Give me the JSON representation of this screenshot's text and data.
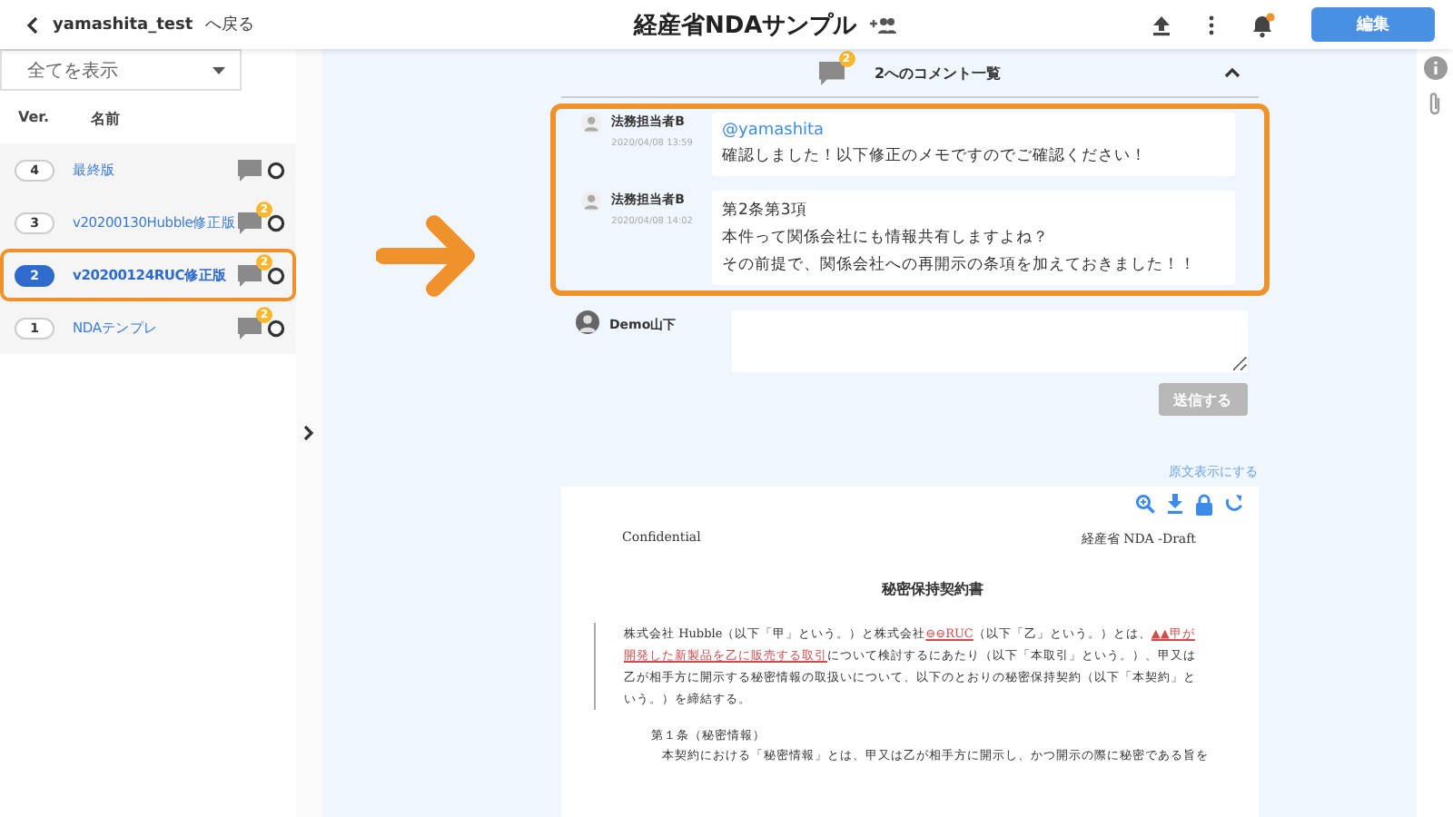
{
  "header": {
    "back_user": "yamashita_test",
    "back_label": "へ戻る",
    "title": "経産省NDAサンプル",
    "notification_dot": true,
    "edit_button": "編集"
  },
  "sidebar": {
    "filter": "全てを表示",
    "columns": [
      "Ver.",
      "名前"
    ],
    "versions": [
      {
        "ver": "4",
        "name": "最終版",
        "selected": false
      },
      {
        "ver": "3",
        "name": "v20200130Hubble修正版",
        "selected": false,
        "badge": "2"
      },
      {
        "ver": "2",
        "name": "v20200124RUC修正版",
        "selected": true,
        "badge": "2"
      },
      {
        "ver": "1",
        "name": "NDAテンプレ",
        "selected": false,
        "badge": "2"
      }
    ]
  },
  "comments": {
    "badge": "2",
    "title": "2へのコメント一覧",
    "expanded": true,
    "items": [
      {
        "author": "法務担当者B",
        "date": "2020/04/08 13:59",
        "mention": "@yamashita",
        "lines": [
          "確認しました！以下修正のメモですのでご確認ください！"
        ]
      },
      {
        "author": "法務担当者B",
        "date": "2020/04/08 14:02",
        "lines": [
          "第2条第3項",
          "本件って関係会社にも情報共有しますよね？",
          "その前提で、関係会社への再開示の条項を加えておきました！！"
        ]
      }
    ],
    "composer": {
      "user": "Demo山下",
      "send_button": "送信する",
      "send_disabled": true
    }
  },
  "document": {
    "toggle_link": "原文表示にする",
    "header_left": "Confidential",
    "header_right": "経産省 NDA -Draft",
    "title": "秘密保持契約書",
    "paragraph": [
      {
        "text": "株式会社 Hubble（以下「甲」という。）と株式会社",
        "changed": false
      },
      {
        "text": "⊖⊖RUC",
        "changed": true
      },
      {
        "text": "（以下「乙」という。）とは、",
        "changed": false
      },
      {
        "text": "▲▲甲が開発した新製品を乙に販売する取引",
        "changed": true
      },
      {
        "text": "について検討するにあたり（以下「本取引」という。）、甲又は乙が相手方に開示する秘密情報の取扱いについて、以下のとおりの秘密保持契約（以下「本契約」という。）を締結する。",
        "changed": false
      }
    ],
    "article_title": "第１条（秘密情報）",
    "article_text": "本契約における「秘密情報」とは、甲又は乙が相手方に開示し、かつ開示の際に秘密である旨を"
  }
}
